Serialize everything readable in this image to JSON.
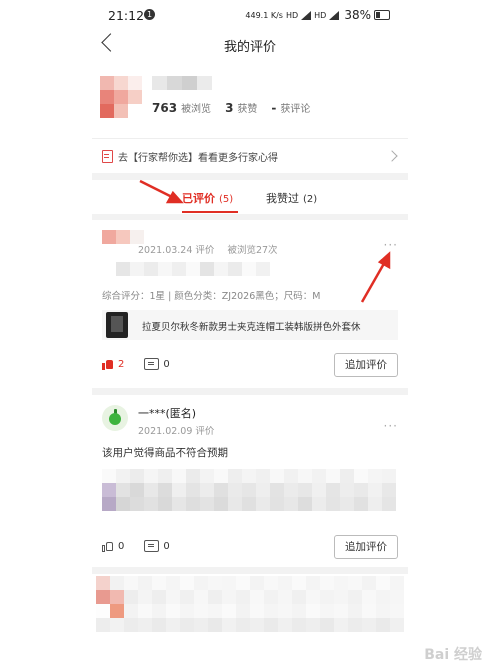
{
  "status_bar": {
    "time": "21:12",
    "notification_count": "1",
    "network_speed": "449.1 K/s",
    "hd1": "HD",
    "hd2": "HD",
    "battery": "38%"
  },
  "header": {
    "title": "我的评价"
  },
  "profile": {
    "views_count": "763",
    "views_label": "被浏览",
    "likes_count": "3",
    "likes_label": "获赞",
    "comments_count": "-",
    "comments_label": "获评论"
  },
  "tip": {
    "text": "去【行家帮你选】看看更多行家心得"
  },
  "tabs": [
    {
      "label": "已评价",
      "count": "(5)"
    },
    {
      "label": "我赞过",
      "count": "(2)"
    }
  ],
  "reviews": [
    {
      "date": "2021.03.24 评价",
      "views": "被浏览27次",
      "details": "综合评分：1星 | 颜色分类：ZJ2026黑色；尺码：M",
      "product_title": "拉夏贝尔秋冬新款男士夹克连帽工装韩版拼色外套休",
      "likes": "2",
      "comments": "0",
      "button_label": "追加评价"
    },
    {
      "username": "一***(匿名)",
      "date": "2021.02.09 评价",
      "text": "该用户觉得商品不符合预期",
      "likes": "0",
      "comments": "0",
      "button_label": "追加评价"
    }
  ],
  "more_menu": "···",
  "colors": {
    "accent": "#e02e24",
    "page_bg": "#f2f2f2"
  },
  "watermark": "Bai 经验"
}
